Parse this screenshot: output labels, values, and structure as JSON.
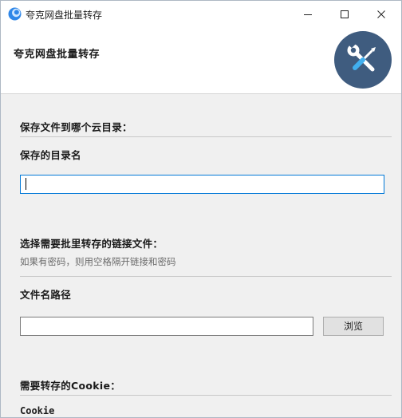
{
  "window": {
    "title": "夸克网盘批量转存",
    "icon": "quark-app-icon"
  },
  "header": {
    "title": "夸克网盘批量转存",
    "badge_icon": "tools-icon",
    "badge_color": "#3f5c7f"
  },
  "save_section": {
    "title": "保存文件到哪个云目录：",
    "dir_label": "保存的目录名",
    "dir_value": ""
  },
  "link_section": {
    "title": "选择需要批里转存的链接文件：",
    "hint": "如果有密码，则用空格隔开链接和密码",
    "path_label": "文件名路径",
    "path_value": "",
    "browse_label": "浏览"
  },
  "cookie_section": {
    "title": "需要转存的Cookie：",
    "cookie_label": "Cookie"
  },
  "colors": {
    "accent": "#0078d7",
    "background": "#f0f0f0"
  }
}
